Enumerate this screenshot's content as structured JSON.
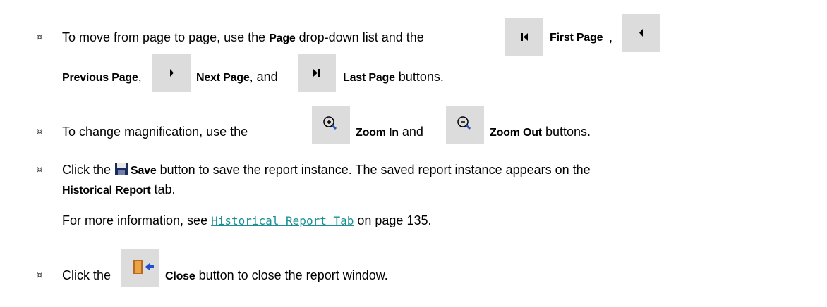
{
  "bullet_char": "¤",
  "item1": {
    "t1": "To move from page to page, use the ",
    "page_label": "Page",
    "t2": " drop-down list and the",
    "first_label": "First Page",
    "comma1": ",",
    "previous_label": "Previous Page",
    "comma2": ",",
    "next_label": "Next Page",
    "and": ", and",
    "last_label": "Last Page",
    "tail": " buttons."
  },
  "item2": {
    "t1": "To change magnification, use the",
    "zoom_in_label": "Zoom In",
    "and": " and",
    "zoom_out_label": "Zoom Out",
    "tail": " buttons."
  },
  "item3": {
    "t1": "Click the ",
    "save_label": "Save",
    "t2": " button to save the report instance. The saved report instance appears on the",
    "historical_label": "Historical Report",
    "t3": " tab.",
    "more_prefix": "For more information, see ",
    "link_text": "Historical Report Tab",
    "more_suffix": " on page 135."
  },
  "item4": {
    "t1": "Click the",
    "close_label": "Close",
    "tail": " button to close the report window."
  },
  "colors": {
    "button_bg": "#dcdcdc",
    "link": "#1a8f94"
  },
  "icons": [
    "first-page-icon",
    "previous-page-icon",
    "next-page-icon",
    "last-page-icon",
    "zoom-in-icon",
    "zoom-out-icon",
    "save-icon",
    "close-icon"
  ]
}
